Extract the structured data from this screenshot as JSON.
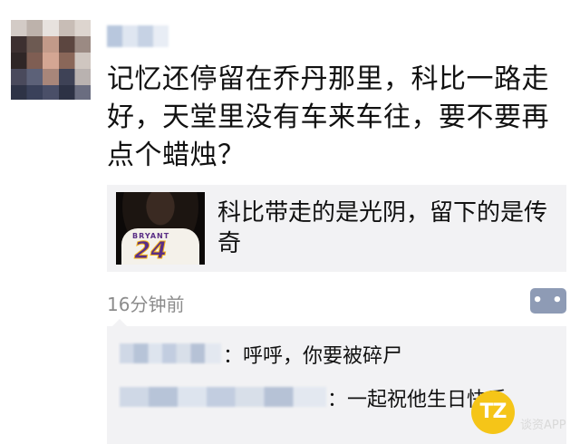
{
  "post": {
    "text": "记忆还停留在乔丹那里，科比一路走好，天堂里没有车来车往，要不要再点个蜡烛？",
    "time": "16分钟前"
  },
  "share": {
    "title": "科比带走的是光阴，留下的是传奇",
    "jersey_name": "BRYANT",
    "jersey_number": "24"
  },
  "comments": [
    {
      "text": "：呼呼，你要被碎尸"
    },
    {
      "text": "：一起祝他生日快乐"
    }
  ],
  "watermark": {
    "logo": "TZ",
    "label": "谈资APP"
  },
  "colors": {
    "comment_button": "#8e9bb5",
    "card_bg": "#f2f2f4",
    "time_gray": "#8c8c8c",
    "watermark_yellow": "#f5c518"
  }
}
